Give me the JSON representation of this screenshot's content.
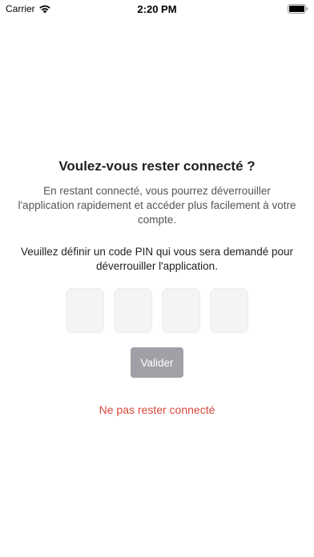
{
  "status_bar": {
    "carrier": "Carrier",
    "time": "2:20 PM"
  },
  "dialog": {
    "title": "Voulez-vous rester connecté ?",
    "subtitle": "En restant connecté, vous pourrez déverrouiller l'application rapidement et accéder plus facilement à votre compte.",
    "pin_instruction": "Veuillez définir un code PIN qui vous sera demandé pour déverrouiller l'application.",
    "pin_boxes": [
      "",
      "",
      "",
      ""
    ],
    "validate_label": "Valider",
    "stay_disconnected_label": "Ne pas rester connecté"
  },
  "icons": {
    "wifi": "wifi-icon",
    "battery": "battery-icon"
  },
  "colors": {
    "link_red": "#d6473b",
    "button_disabled": "#a0a1a6",
    "pin_box_bg": "#f4f4f4"
  }
}
